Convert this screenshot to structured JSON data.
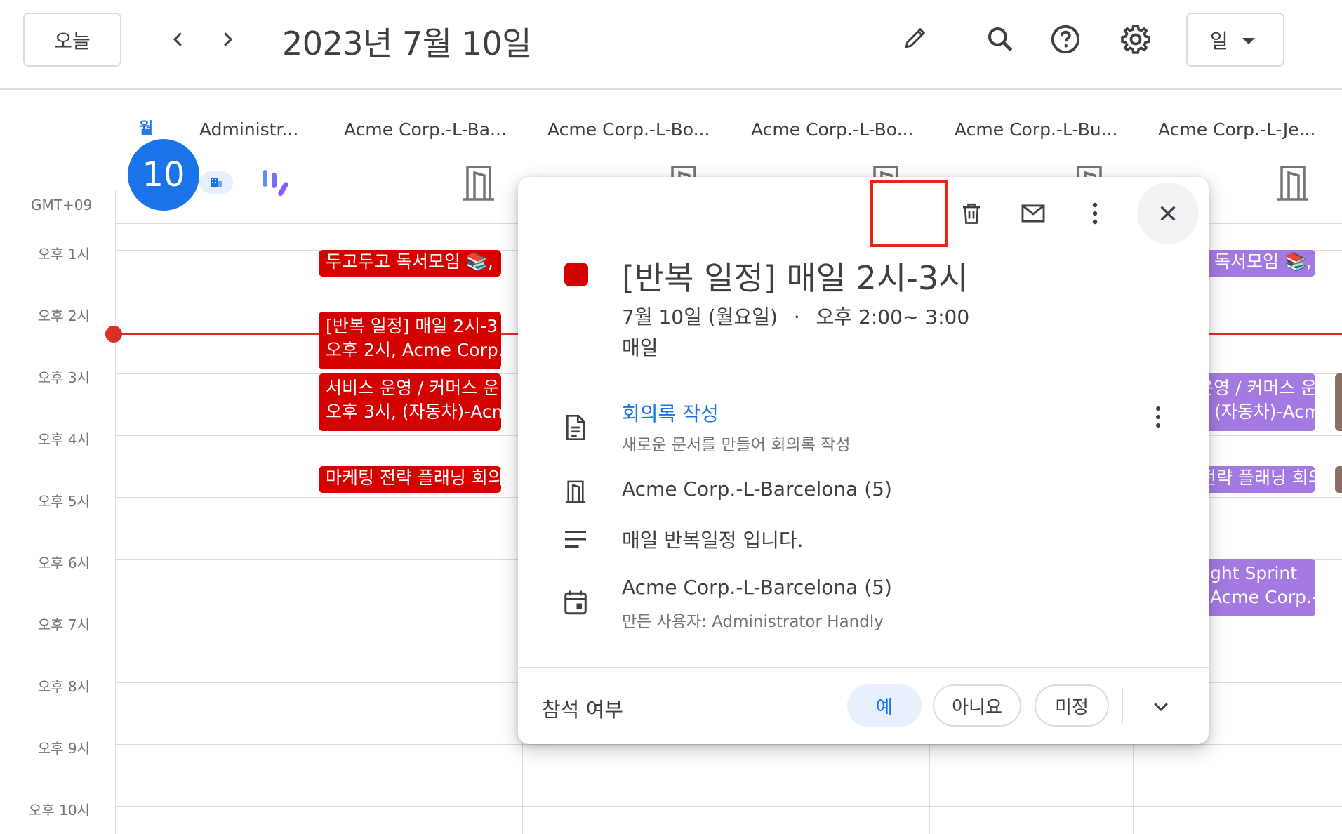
{
  "header": {
    "today_label": "오늘",
    "date_title": "2023년 7월 10일",
    "view_label": "일"
  },
  "day": {
    "weekday": "월",
    "number": "10",
    "timezone": "GMT+09"
  },
  "columns": [
    "Administr...",
    "Acme Corp.-L-Ba...",
    "Acme Corp.-L-Bo...",
    "Acme Corp.-L-Bo...",
    "Acme Corp.-L-Bu...",
    "Acme Corp.-L-Je..."
  ],
  "time_labels": [
    "오후 1시",
    "오후 2시",
    "오후 3시",
    "오후 4시",
    "오후 5시",
    "오후 6시",
    "오후 7시",
    "오후 8시",
    "오후 9시",
    "오후 10시"
  ],
  "events": {
    "e1": "두고두고 독서모임 📚,",
    "e2_line1": "[반복 일정] 매일 2시-3",
    "e2_line2": "오후 2시, Acme Corp.-",
    "e3_line1": "서비스 운영 / 커머스 운",
    "e3_line2": "오후 3시, (자동차)-Acm",
    "e4": "마케팅 전략 플래닝 회의",
    "r1": "독서모임 📚,",
    "r2_line1": "운영 / 커머스 운",
    "r2_line2": "(자동차)-Acm",
    "r3": "전략 플래닝 회의",
    "r4_line1": "ght Sprint",
    "r4_line2": "Acme Corp.-"
  },
  "popup": {
    "title": "[반복 일정] 매일 2시-3시",
    "date": "7월 10일 (월요일)",
    "dot": "·",
    "time": "오후 2:00~ 3:00",
    "recurrence": "매일",
    "notes_link": "회의록 작성",
    "notes_sub": "새로운 문서를 만들어 회의록 작성",
    "room": "Acme Corp.-L-Barcelona (5)",
    "description": "매일 반복일정 입니다.",
    "calendar": "Acme Corp.-L-Barcelona (5)",
    "creator": "만든 사용자: Administrator Handly",
    "rsvp_label": "참석 여부",
    "rsvp_yes": "예",
    "rsvp_no": "아니요",
    "rsvp_maybe": "미정"
  },
  "colors": {
    "accent": "#1a73e8",
    "event_red": "#d50000",
    "event_purple": "#a47ae2",
    "now_line": "#d93025",
    "highlight": "#e8250e"
  }
}
